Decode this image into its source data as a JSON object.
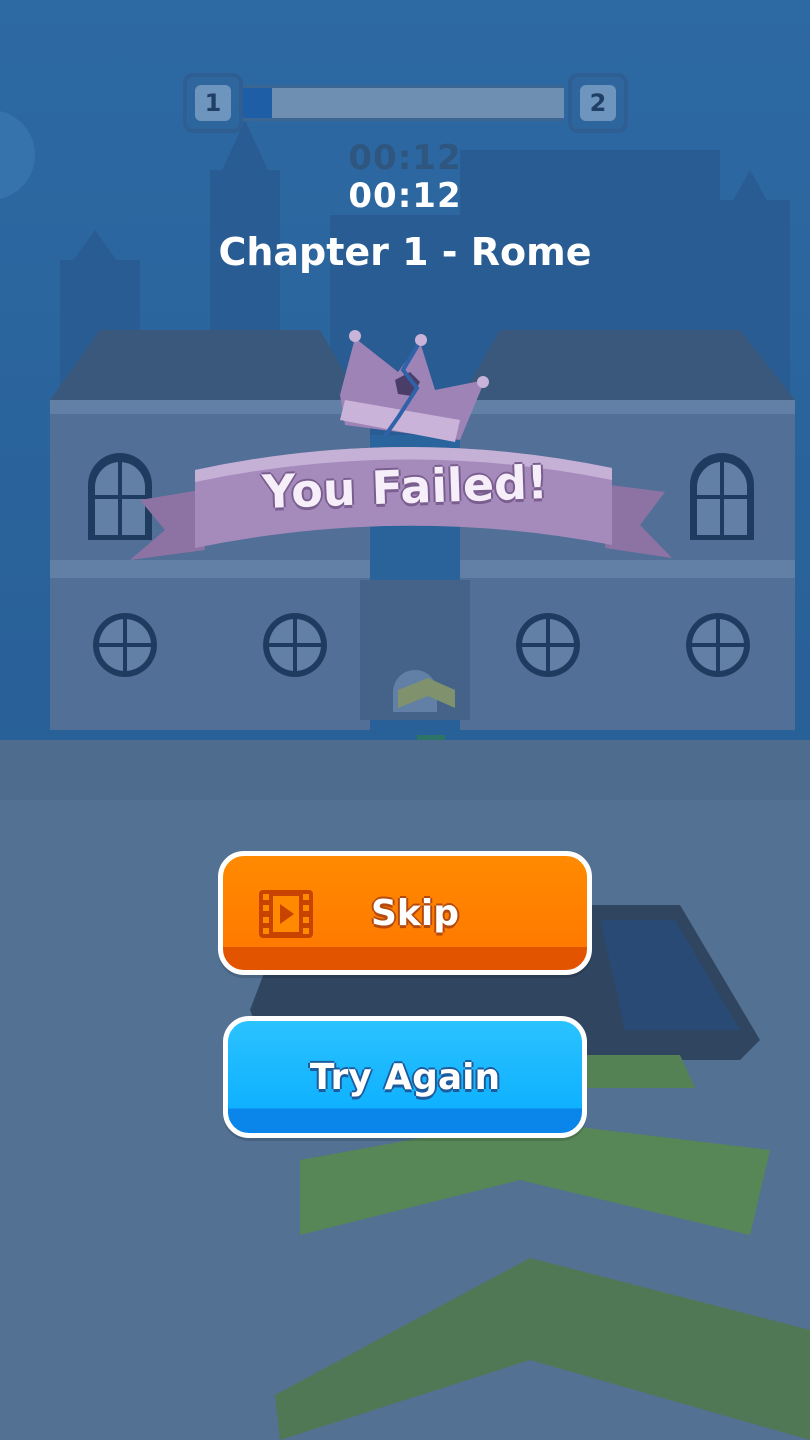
{
  "hud": {
    "current_level": "1",
    "next_level": "2",
    "progress": 0.09,
    "timer_ghost": "00:12",
    "timer": "00:12",
    "chapter_title": "Chapter 1 - Rome"
  },
  "result": {
    "banner_text": "You Failed!"
  },
  "actions": {
    "skip_label": "Skip",
    "skip_icon": "video-ad-icon",
    "try_again_label": "Try Again"
  },
  "colors": {
    "skip_button": "#ff8000",
    "try_again_button": "#10b4ff",
    "banner": "#9a82b0",
    "progress_fill": "#1d5ea6"
  }
}
